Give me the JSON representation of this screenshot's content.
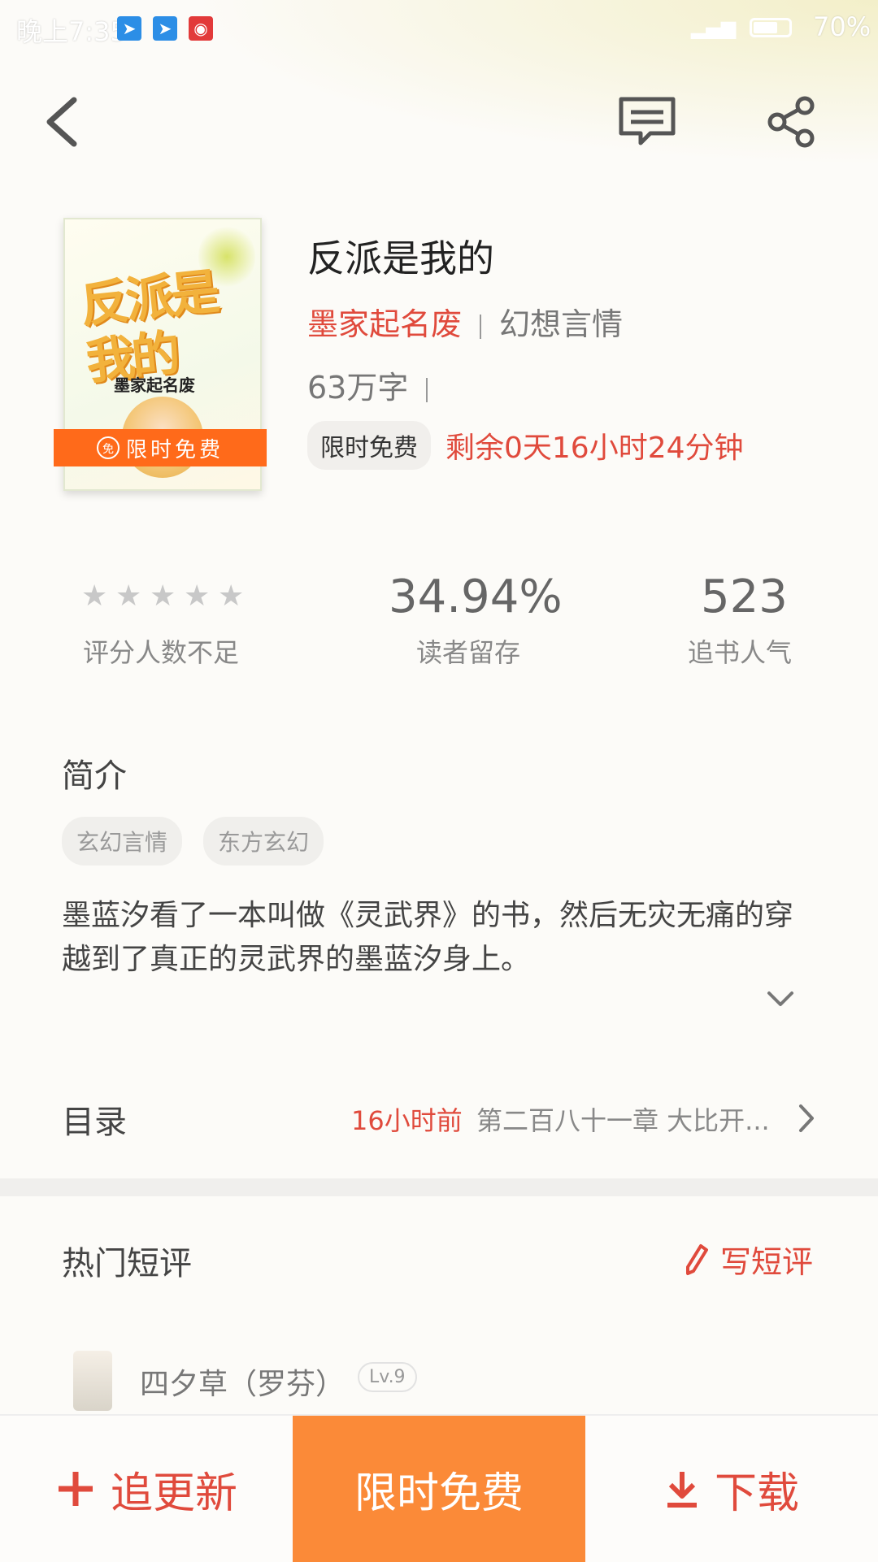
{
  "status_bar": {
    "time": "晚上7:35",
    "battery_percent": "70%",
    "battery_level": 0.7,
    "notification_icons": [
      "telegram-icon",
      "telegram-icon",
      "weibo-icon"
    ]
  },
  "nav": {
    "back_icon": "back-arrow-icon",
    "comment_icon": "comment-icon",
    "share_icon": "share-icon"
  },
  "book": {
    "cover_title": "反派是我的",
    "cover_author": "墨家起名废",
    "cover_badge": "限时免费",
    "cover_badge_icon": "免",
    "title": "反派是我的",
    "author": "墨家起名废",
    "genre": "幻想言情",
    "word_count": "63万字",
    "free_chip": "限时免费",
    "countdown": "剩余0天16小时24分钟"
  },
  "stats": {
    "rating_label": "评分人数不足",
    "rating_stars": 0,
    "retention_value": "34.94%",
    "retention_label": "读者留存",
    "popularity_value": "523",
    "popularity_label": "追书人气"
  },
  "intro": {
    "title": "简介",
    "tags": [
      "玄幻言情",
      "东方玄幻"
    ],
    "text": "墨蓝汐看了一本叫做《灵武界》的书，然后无灾无痛的穿越到了真正的灵武界的墨蓝汐身上。"
  },
  "catalog": {
    "title": "目录",
    "updated": "16小时前",
    "latest_chapter": "第二百八十一章 大比开..."
  },
  "reviews": {
    "title": "热门短评",
    "write_label": "写短评",
    "first_user": {
      "name": "四夕草（罗芬）",
      "level": "Lv.9"
    }
  },
  "bottom": {
    "follow_label": "追更新",
    "read_label": "限时免费",
    "download_label": "下载"
  },
  "colors": {
    "accent_red": "#e04a3c",
    "accent_orange": "#fb8a38",
    "badge_orange": "#ff6a1a"
  }
}
